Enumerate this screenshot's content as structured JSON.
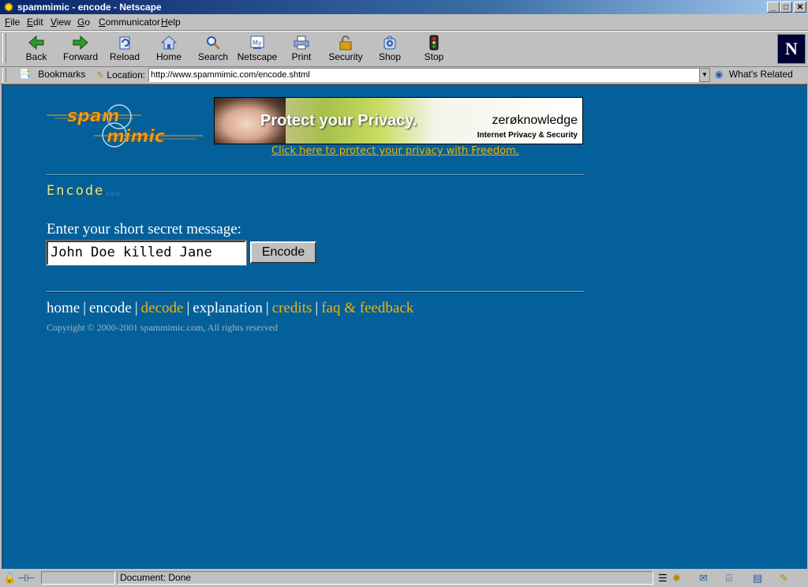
{
  "window": {
    "title": "spammimic - encode - Netscape",
    "app_icon": "netscape-star-icon",
    "controls": {
      "minimize": "_",
      "maximize": "□",
      "close": "✕"
    }
  },
  "menu": [
    "File",
    "Edit",
    "View",
    "Go",
    "Communicator",
    "Help"
  ],
  "toolbar": [
    {
      "label": "Back",
      "icon": "back-icon",
      "color": "#2e9a2e"
    },
    {
      "label": "Forward",
      "icon": "forward-icon",
      "color": "#2e9a2e"
    },
    {
      "label": "Reload",
      "icon": "reload-icon",
      "color": "#2a56a8"
    },
    {
      "label": "Home",
      "icon": "home-icon",
      "color": "#3a5ea8"
    },
    {
      "label": "Search",
      "icon": "search-icon",
      "color": "#2a56a8"
    },
    {
      "label": "Netscape",
      "icon": "my-netscape-icon",
      "color": "#3a5ea8"
    },
    {
      "label": "Print",
      "icon": "print-icon",
      "color": "#3a5ea8"
    },
    {
      "label": "Security",
      "icon": "lock-icon",
      "color": "#b8860b"
    },
    {
      "label": "Shop",
      "icon": "shop-icon",
      "color": "#2a56a8"
    },
    {
      "label": "Stop",
      "icon": "stop-icon",
      "color": "#c02020"
    }
  ],
  "location": {
    "bookmarks_label": "Bookmarks",
    "location_label": "Location:",
    "url": "http://www.spammimic.com/encode.shtml",
    "related_label": "What's Related"
  },
  "page": {
    "logo_line1": "spam",
    "logo_line2": "mimic",
    "banner": {
      "headline": "Protect your Privacy.",
      "brand": "zerøknowledge",
      "tagline": "Internet Privacy & Security",
      "link": "Click here to protect your privacy with Freedom."
    },
    "section_title": "Encode",
    "section_dots": "○○○",
    "prompt": "Enter your short secret message:",
    "message_value": "John Doe killed Jane",
    "encode_button": "Encode",
    "nav": {
      "home": "home",
      "encode": "encode",
      "decode": "decode",
      "explanation": "explanation",
      "credits": "credits",
      "faq": "faq & feedback",
      "separator": "|"
    },
    "copyright": "Copyright © 2000-2001 spammimic.com, All rights reserved"
  },
  "status": {
    "text": "Document: Done"
  },
  "colors": {
    "page_background": "#04609a",
    "accent_orange": "#f0b400",
    "title_bar": "#0a246a"
  }
}
